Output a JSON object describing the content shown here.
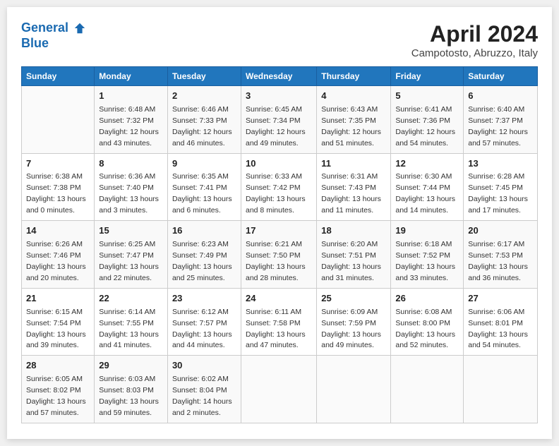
{
  "header": {
    "logo_line1": "General",
    "logo_line2": "Blue",
    "month": "April 2024",
    "location": "Campotosto, Abruzzo, Italy"
  },
  "weekdays": [
    "Sunday",
    "Monday",
    "Tuesday",
    "Wednesday",
    "Thursday",
    "Friday",
    "Saturday"
  ],
  "weeks": [
    [
      {
        "day": null
      },
      {
        "day": "1",
        "sunrise": "6:48 AM",
        "sunset": "7:32 PM",
        "daylight": "12 hours and 43 minutes."
      },
      {
        "day": "2",
        "sunrise": "6:46 AM",
        "sunset": "7:33 PM",
        "daylight": "12 hours and 46 minutes."
      },
      {
        "day": "3",
        "sunrise": "6:45 AM",
        "sunset": "7:34 PM",
        "daylight": "12 hours and 49 minutes."
      },
      {
        "day": "4",
        "sunrise": "6:43 AM",
        "sunset": "7:35 PM",
        "daylight": "12 hours and 51 minutes."
      },
      {
        "day": "5",
        "sunrise": "6:41 AM",
        "sunset": "7:36 PM",
        "daylight": "12 hours and 54 minutes."
      },
      {
        "day": "6",
        "sunrise": "6:40 AM",
        "sunset": "7:37 PM",
        "daylight": "12 hours and 57 minutes."
      }
    ],
    [
      {
        "day": "7",
        "sunrise": "6:38 AM",
        "sunset": "7:38 PM",
        "daylight": "13 hours and 0 minutes."
      },
      {
        "day": "8",
        "sunrise": "6:36 AM",
        "sunset": "7:40 PM",
        "daylight": "13 hours and 3 minutes."
      },
      {
        "day": "9",
        "sunrise": "6:35 AM",
        "sunset": "7:41 PM",
        "daylight": "13 hours and 6 minutes."
      },
      {
        "day": "10",
        "sunrise": "6:33 AM",
        "sunset": "7:42 PM",
        "daylight": "13 hours and 8 minutes."
      },
      {
        "day": "11",
        "sunrise": "6:31 AM",
        "sunset": "7:43 PM",
        "daylight": "13 hours and 11 minutes."
      },
      {
        "day": "12",
        "sunrise": "6:30 AM",
        "sunset": "7:44 PM",
        "daylight": "13 hours and 14 minutes."
      },
      {
        "day": "13",
        "sunrise": "6:28 AM",
        "sunset": "7:45 PM",
        "daylight": "13 hours and 17 minutes."
      }
    ],
    [
      {
        "day": "14",
        "sunrise": "6:26 AM",
        "sunset": "7:46 PM",
        "daylight": "13 hours and 20 minutes."
      },
      {
        "day": "15",
        "sunrise": "6:25 AM",
        "sunset": "7:47 PM",
        "daylight": "13 hours and 22 minutes."
      },
      {
        "day": "16",
        "sunrise": "6:23 AM",
        "sunset": "7:49 PM",
        "daylight": "13 hours and 25 minutes."
      },
      {
        "day": "17",
        "sunrise": "6:21 AM",
        "sunset": "7:50 PM",
        "daylight": "13 hours and 28 minutes."
      },
      {
        "day": "18",
        "sunrise": "6:20 AM",
        "sunset": "7:51 PM",
        "daylight": "13 hours and 31 minutes."
      },
      {
        "day": "19",
        "sunrise": "6:18 AM",
        "sunset": "7:52 PM",
        "daylight": "13 hours and 33 minutes."
      },
      {
        "day": "20",
        "sunrise": "6:17 AM",
        "sunset": "7:53 PM",
        "daylight": "13 hours and 36 minutes."
      }
    ],
    [
      {
        "day": "21",
        "sunrise": "6:15 AM",
        "sunset": "7:54 PM",
        "daylight": "13 hours and 39 minutes."
      },
      {
        "day": "22",
        "sunrise": "6:14 AM",
        "sunset": "7:55 PM",
        "daylight": "13 hours and 41 minutes."
      },
      {
        "day": "23",
        "sunrise": "6:12 AM",
        "sunset": "7:57 PM",
        "daylight": "13 hours and 44 minutes."
      },
      {
        "day": "24",
        "sunrise": "6:11 AM",
        "sunset": "7:58 PM",
        "daylight": "13 hours and 47 minutes."
      },
      {
        "day": "25",
        "sunrise": "6:09 AM",
        "sunset": "7:59 PM",
        "daylight": "13 hours and 49 minutes."
      },
      {
        "day": "26",
        "sunrise": "6:08 AM",
        "sunset": "8:00 PM",
        "daylight": "13 hours and 52 minutes."
      },
      {
        "day": "27",
        "sunrise": "6:06 AM",
        "sunset": "8:01 PM",
        "daylight": "13 hours and 54 minutes."
      }
    ],
    [
      {
        "day": "28",
        "sunrise": "6:05 AM",
        "sunset": "8:02 PM",
        "daylight": "13 hours and 57 minutes."
      },
      {
        "day": "29",
        "sunrise": "6:03 AM",
        "sunset": "8:03 PM",
        "daylight": "13 hours and 59 minutes."
      },
      {
        "day": "30",
        "sunrise": "6:02 AM",
        "sunset": "8:04 PM",
        "daylight": "14 hours and 2 minutes."
      },
      {
        "day": null
      },
      {
        "day": null
      },
      {
        "day": null
      },
      {
        "day": null
      }
    ]
  ]
}
